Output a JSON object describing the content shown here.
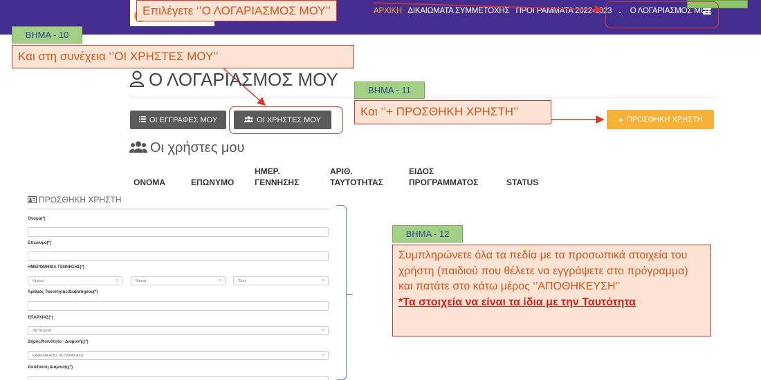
{
  "navbar": {
    "items": [
      "ΑΡΧΙΚΗ",
      "ΔΙΚΑΙΩΜΑΤΑ ΣΥΜΜΕΤΟΧΗΣ",
      "ΠΡΟΓΡΑΜΜΑΤΑ 2022-2023",
      "Ο ΛΟΓΑΡΙΑΣΜΟΣ ΜΟΥ"
    ],
    "caret": "⌄"
  },
  "annotations": {
    "step9_text": "Επιλέγετε ‘’Ο ΛΟΓΑΡΙΑΣΜΟΣ ΜΟΥ’’",
    "step10_label": "ΒΗΜΑ - 10",
    "step10_text": "Και στη συνέχεια ‘’ΟΙ ΧΡΗΣΤΕΣ ΜΟΥ’’",
    "step11_label": "ΒΗΜΑ - 11",
    "step11_text": "Και ‘’+ ΠΡΟΣΘΗΚΗ ΧΡΗΣΤΗ’’",
    "step12_label": "ΒΗΜΑ - 12",
    "step12_text": "Συμπληρώνετε όλα τα πεδία με τα προσωπικά στοιχεία του χρήστη (παιδιού που θέλετε να εγγράψετε στο πρόγραμμα) και πατάτε στο κάτω μέρος ‘’ΑΠΟΘΗΚΕΥΣΗ’’",
    "step12_warning": "*Τα στοιχεία να είναι τα ίδια με την Ταυτότητα"
  },
  "page": {
    "title": "Ο ΛΟΓΑΡΙΑΣΜΟΣ ΜΟΥ",
    "btn_registrations": "ΟΙ ΕΓΓΡΑΦΕΣ ΜΟΥ",
    "btn_users": "ΟΙ ΧΡΗΣΤΕΣ ΜΟΥ",
    "btn_add_user": "ΠΡΟΣΘΗΚΗ ΧΡΗΣΤΗ",
    "section_title": "Οι χρήστες μου",
    "columns": [
      [
        "ΟΝΟΜΑ"
      ],
      [
        "ΕΠΩΝΥΜΟ"
      ],
      [
        "ΗΜΕΡ.",
        "ΓΕΝΝΗΣΗΣ"
      ],
      [
        "ΑΡΙΘ.",
        "ΤΑΥΤΟΤΗΤΑΣ"
      ],
      [
        "ΕΙΔΟΣ",
        "ΠΡΟΓΡΑΜΜΑΤΟΣ"
      ],
      [
        "STATUS"
      ]
    ]
  },
  "form": {
    "title": "ΠΡΟΣΘΗΚΗ ΧΡΗΣΤΗ",
    "first_name_label": "Όνομα(*)",
    "last_name_label": "Επώνυμο(*)",
    "birthdate_label": "ΗΜΕΡΟΜΗΝΙΑ ΓΕΝΝΗΣΗΣ(*)",
    "day_placeholder": "Ημέρα",
    "month_placeholder": "Μήνας",
    "year_placeholder": "Έτος",
    "id_label": "Αριθμός Ταυτότητας/Διαβατηρίου(*)",
    "district_label": "ΕΠΑΡΧΙΑΣ(*)",
    "district_value": "ΛΕΥΚΩΣΙΑ",
    "municipality_label": "Δήμος/Κοινότητα - Διαμονής(*)",
    "municipality_value": "ΚΑΝΕΝΑ ΑΠΟ ΤΑ ΠΑΡΑΚΑΤΩ",
    "address_label": "Διεύθυνση Διαμονής(*)"
  }
}
